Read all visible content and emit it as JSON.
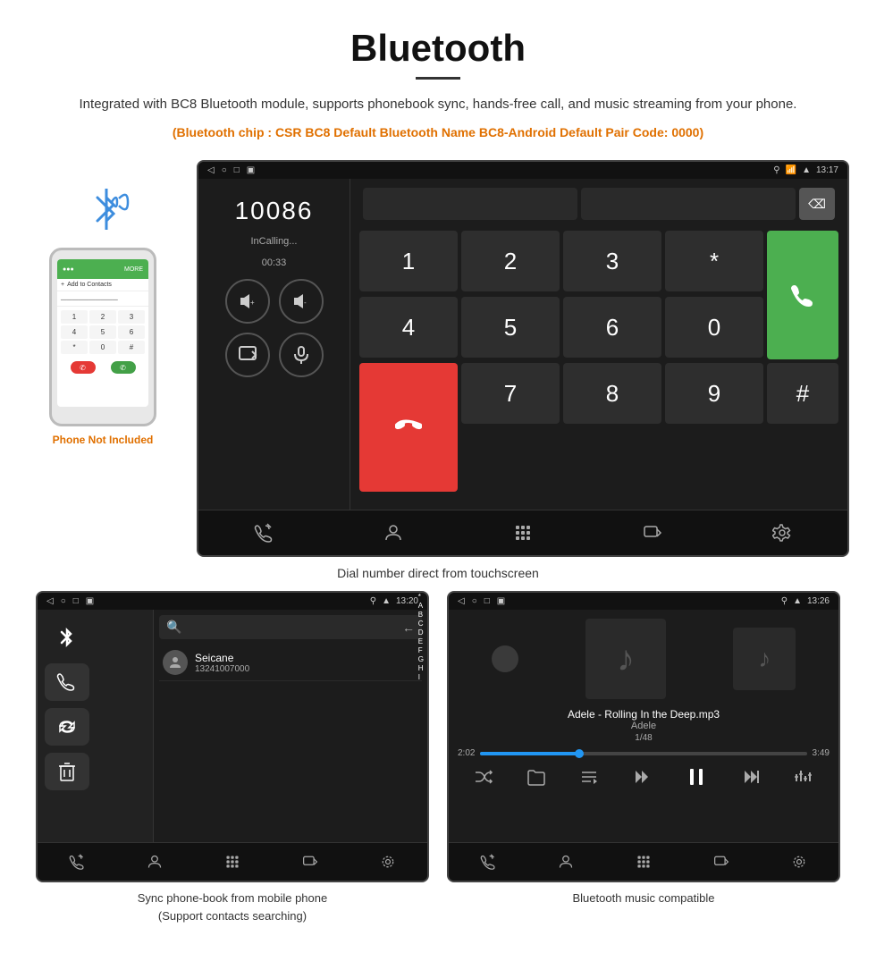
{
  "header": {
    "title": "Bluetooth",
    "description": "Integrated with BC8 Bluetooth module, supports phonebook sync, hands-free call, and music streaming from your phone.",
    "specs": "(Bluetooth chip : CSR BC8    Default Bluetooth Name BC8-Android    Default Pair Code: 0000)"
  },
  "dial_screen": {
    "statusbar": {
      "left_icons": [
        "back",
        "home",
        "square"
      ],
      "right": "13:17",
      "signal_icons": [
        "location",
        "phone",
        "wifi",
        "signal"
      ]
    },
    "phone_number": "10086",
    "status": "InCalling...",
    "timer": "00:33",
    "numpad": [
      "1",
      "2",
      "3",
      "*",
      "4",
      "5",
      "6",
      "0",
      "7",
      "8",
      "9",
      "#"
    ],
    "call_btn_color": "#4caf50",
    "end_btn_color": "#e53935"
  },
  "caption_dial": "Dial number direct from touchscreen",
  "phonebook_screen": {
    "statusbar_right": "13:20",
    "contact_name": "Seicane",
    "contact_number": "13241007000",
    "alpha_letters": [
      "*",
      "A",
      "B",
      "C",
      "D",
      "E",
      "F",
      "G",
      "H",
      "I"
    ]
  },
  "caption_phonebook_line1": "Sync phone-book from mobile phone",
  "caption_phonebook_line2": "(Support contacts searching)",
  "music_screen": {
    "statusbar_right": "13:26",
    "song_title": "Adele - Rolling In the Deep.mp3",
    "artist": "Adele",
    "track": "1/48",
    "current_time": "2:02",
    "total_time": "3:49",
    "progress_percent": 30
  },
  "caption_music": "Bluetooth music compatible",
  "phone_not_included": "Phone Not Included"
}
